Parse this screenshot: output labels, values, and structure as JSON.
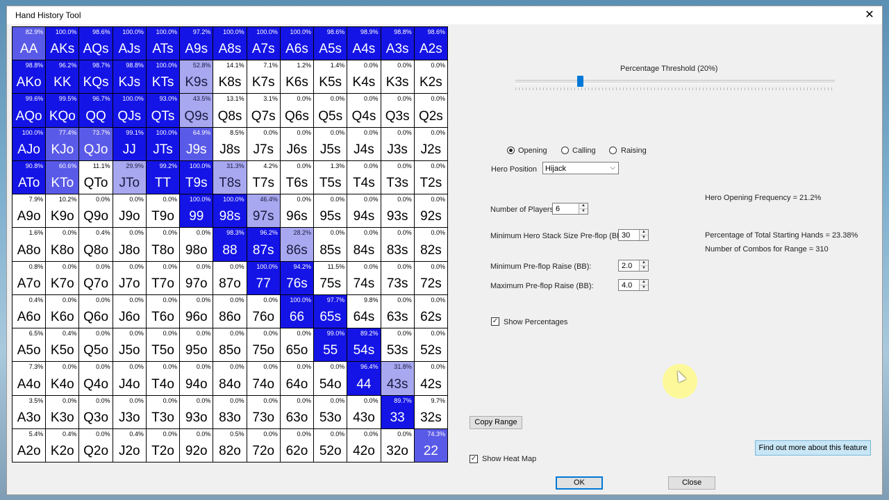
{
  "window": {
    "title": "Hand History Tool",
    "close_glyph": "✕"
  },
  "grid": {
    "rows": [
      [
        [
          "82.9%",
          "AA"
        ],
        [
          "100.0%",
          "AKs"
        ],
        [
          "98.6%",
          "AQs"
        ],
        [
          "100.0%",
          "AJs"
        ],
        [
          "100.0%",
          "ATs"
        ],
        [
          "97.2%",
          "A9s"
        ],
        [
          "100.0%",
          "A8s"
        ],
        [
          "100.0%",
          "A7s"
        ],
        [
          "100.0%",
          "A6s"
        ],
        [
          "98.6%",
          "A5s"
        ],
        [
          "98.9%",
          "A4s"
        ],
        [
          "98.8%",
          "A3s"
        ],
        [
          "98.6%",
          "A2s"
        ]
      ],
      [
        [
          "98.8%",
          "AKo"
        ],
        [
          "96.2%",
          "KK"
        ],
        [
          "98.7%",
          "KQs"
        ],
        [
          "98.8%",
          "KJs"
        ],
        [
          "100.0%",
          "KTs"
        ],
        [
          "52.8%",
          "K9s"
        ],
        [
          "14.1%",
          "K8s"
        ],
        [
          "7.1%",
          "K7s"
        ],
        [
          "1.2%",
          "K6s"
        ],
        [
          "1.4%",
          "K5s"
        ],
        [
          "0.0%",
          "K4s"
        ],
        [
          "0.0%",
          "K3s"
        ],
        [
          "0.0%",
          "K2s"
        ]
      ],
      [
        [
          "99.6%",
          "AQo"
        ],
        [
          "99.5%",
          "KQo"
        ],
        [
          "96.7%",
          "QQ"
        ],
        [
          "100.0%",
          "QJs"
        ],
        [
          "93.0%",
          "QTs"
        ],
        [
          "43.5%",
          "Q9s"
        ],
        [
          "13.1%",
          "Q8s"
        ],
        [
          "3.1%",
          "Q7s"
        ],
        [
          "0.0%",
          "Q6s"
        ],
        [
          "0.0%",
          "Q5s"
        ],
        [
          "0.0%",
          "Q4s"
        ],
        [
          "0.0%",
          "Q3s"
        ],
        [
          "0.0%",
          "Q2s"
        ]
      ],
      [
        [
          "100.0%",
          "AJo"
        ],
        [
          "77.4%",
          "KJo"
        ],
        [
          "73.7%",
          "QJo"
        ],
        [
          "99.1%",
          "JJ"
        ],
        [
          "100.0%",
          "JTs"
        ],
        [
          "64.9%",
          "J9s"
        ],
        [
          "8.5%",
          "J8s"
        ],
        [
          "0.0%",
          "J7s"
        ],
        [
          "0.0%",
          "J6s"
        ],
        [
          "0.0%",
          "J5s"
        ],
        [
          "0.0%",
          "J4s"
        ],
        [
          "0.0%",
          "J3s"
        ],
        [
          "0.0%",
          "J2s"
        ]
      ],
      [
        [
          "90.8%",
          "ATo"
        ],
        [
          "60.6%",
          "KTo"
        ],
        [
          "11.1%",
          "QTo"
        ],
        [
          "29.9%",
          "JTo"
        ],
        [
          "99.2%",
          "TT"
        ],
        [
          "100.0%",
          "T9s"
        ],
        [
          "31.3%",
          "T8s"
        ],
        [
          "4.2%",
          "T7s"
        ],
        [
          "0.0%",
          "T6s"
        ],
        [
          "1.3%",
          "T5s"
        ],
        [
          "0.0%",
          "T4s"
        ],
        [
          "0.0%",
          "T3s"
        ],
        [
          "0.0%",
          "T2s"
        ]
      ],
      [
        [
          "7.9%",
          "A9o"
        ],
        [
          "10.2%",
          "K9o"
        ],
        [
          "0.0%",
          "Q9o"
        ],
        [
          "0.0%",
          "J9o"
        ],
        [
          "0.0%",
          "T9o"
        ],
        [
          "100.0%",
          "99"
        ],
        [
          "100.0%",
          "98s"
        ],
        [
          "46.4%",
          "97s"
        ],
        [
          "0.0%",
          "96s"
        ],
        [
          "0.0%",
          "95s"
        ],
        [
          "0.0%",
          "94s"
        ],
        [
          "0.0%",
          "93s"
        ],
        [
          "0.0%",
          "92s"
        ]
      ],
      [
        [
          "1.6%",
          "A8o"
        ],
        [
          "0.0%",
          "K8o"
        ],
        [
          "0.4%",
          "Q8o"
        ],
        [
          "0.0%",
          "J8o"
        ],
        [
          "0.0%",
          "T8o"
        ],
        [
          "0.0%",
          "98o"
        ],
        [
          "98.3%",
          "88"
        ],
        [
          "96.2%",
          "87s"
        ],
        [
          "28.2%",
          "86s"
        ],
        [
          "0.0%",
          "85s"
        ],
        [
          "0.0%",
          "84s"
        ],
        [
          "0.0%",
          "83s"
        ],
        [
          "0.0%",
          "82s"
        ]
      ],
      [
        [
          "0.8%",
          "A7o"
        ],
        [
          "0.0%",
          "K7o"
        ],
        [
          "0.0%",
          "Q7o"
        ],
        [
          "0.0%",
          "J7o"
        ],
        [
          "0.0%",
          "T7o"
        ],
        [
          "0.0%",
          "97o"
        ],
        [
          "0.0%",
          "87o"
        ],
        [
          "100.0%",
          "77"
        ],
        [
          "94.2%",
          "76s"
        ],
        [
          "11.5%",
          "75s"
        ],
        [
          "0.0%",
          "74s"
        ],
        [
          "0.0%",
          "73s"
        ],
        [
          "0.0%",
          "72s"
        ]
      ],
      [
        [
          "0.4%",
          "A6o"
        ],
        [
          "0.0%",
          "K6o"
        ],
        [
          "0.0%",
          "Q6o"
        ],
        [
          "0.0%",
          "J6o"
        ],
        [
          "0.0%",
          "T6o"
        ],
        [
          "0.0%",
          "96o"
        ],
        [
          "0.0%",
          "86o"
        ],
        [
          "0.0%",
          "76o"
        ],
        [
          "100.0%",
          "66"
        ],
        [
          "97.7%",
          "65s"
        ],
        [
          "9.8%",
          "64s"
        ],
        [
          "0.0%",
          "63s"
        ],
        [
          "0.0%",
          "62s"
        ]
      ],
      [
        [
          "6.5%",
          "A5o"
        ],
        [
          "0.4%",
          "K5o"
        ],
        [
          "0.0%",
          "Q5o"
        ],
        [
          "0.0%",
          "J5o"
        ],
        [
          "0.0%",
          "T5o"
        ],
        [
          "0.0%",
          "95o"
        ],
        [
          "0.0%",
          "85o"
        ],
        [
          "0.0%",
          "75o"
        ],
        [
          "0.0%",
          "65o"
        ],
        [
          "99.0%",
          "55"
        ],
        [
          "89.2%",
          "54s"
        ],
        [
          "0.0%",
          "53s"
        ],
        [
          "0.0%",
          "52s"
        ]
      ],
      [
        [
          "7.3%",
          "A4o"
        ],
        [
          "0.0%",
          "K4o"
        ],
        [
          "0.0%",
          "Q4o"
        ],
        [
          "0.0%",
          "J4o"
        ],
        [
          "0.0%",
          "T4o"
        ],
        [
          "0.0%",
          "94o"
        ],
        [
          "0.0%",
          "84o"
        ],
        [
          "0.0%",
          "74o"
        ],
        [
          "0.0%",
          "64o"
        ],
        [
          "0.0%",
          "54o"
        ],
        [
          "96.4%",
          "44"
        ],
        [
          "31.8%",
          "43s"
        ],
        [
          "0.0%",
          "42s"
        ]
      ],
      [
        [
          "3.5%",
          "A3o"
        ],
        [
          "0.0%",
          "K3o"
        ],
        [
          "0.0%",
          "Q3o"
        ],
        [
          "0.0%",
          "J3o"
        ],
        [
          "0.0%",
          "T3o"
        ],
        [
          "0.0%",
          "93o"
        ],
        [
          "0.0%",
          "83o"
        ],
        [
          "0.0%",
          "73o"
        ],
        [
          "0.0%",
          "63o"
        ],
        [
          "0.0%",
          "53o"
        ],
        [
          "0.0%",
          "43o"
        ],
        [
          "89.7%",
          "33"
        ],
        [
          "9.7%",
          "32s"
        ]
      ],
      [
        [
          "5.4%",
          "A2o"
        ],
        [
          "0.4%",
          "K2o"
        ],
        [
          "0.0%",
          "Q2o"
        ],
        [
          "0.4%",
          "J2o"
        ],
        [
          "0.0%",
          "T2o"
        ],
        [
          "0.0%",
          "92o"
        ],
        [
          "0.5%",
          "82o"
        ],
        [
          "0.0%",
          "72o"
        ],
        [
          "0.0%",
          "62o"
        ],
        [
          "0.0%",
          "52o"
        ],
        [
          "0.0%",
          "42o"
        ],
        [
          "0.0%",
          "32o"
        ],
        [
          "74.3%",
          "22"
        ]
      ]
    ],
    "colors": {
      "full": "#1414e6",
      "mid": "#5a5ae8",
      "light": "#a8a8f0",
      "none": "#ffffff"
    }
  },
  "threshold": {
    "label": "Percentage Threshold (20%)",
    "value_percent": 20
  },
  "mode": {
    "options": [
      "Opening",
      "Calling",
      "Raising"
    ],
    "selected": "Opening"
  },
  "hero_position": {
    "label": "Hero Position",
    "value": "Hijack"
  },
  "number_of_players": {
    "label": "Number of Players",
    "value": "6"
  },
  "min_stack": {
    "label": "Minimum Hero Stack Size Pre-flop (BB)",
    "value": "30"
  },
  "min_raise": {
    "label": "Minimum Pre-flop Raise (BB):",
    "value": "2.0"
  },
  "max_raise": {
    "label": "Maximum Pre-flop Raise (BB):",
    "value": "4.0"
  },
  "show_percentages": {
    "label": "Show Percentages",
    "checked": true
  },
  "stats": {
    "opening_frequency": "Hero Opening Frequency = 21.2%",
    "total_starting_hands": "Percentage of Total Starting Hands = 23.38%",
    "combos": "Number of Combos for Range = 310"
  },
  "copy_range_button": "Copy Range",
  "show_heat_map": {
    "label": "Show Heat Map",
    "checked": true
  },
  "find_out_more_button": "Find out more about this feature",
  "ok_button": "OK",
  "close_button": "Close"
}
